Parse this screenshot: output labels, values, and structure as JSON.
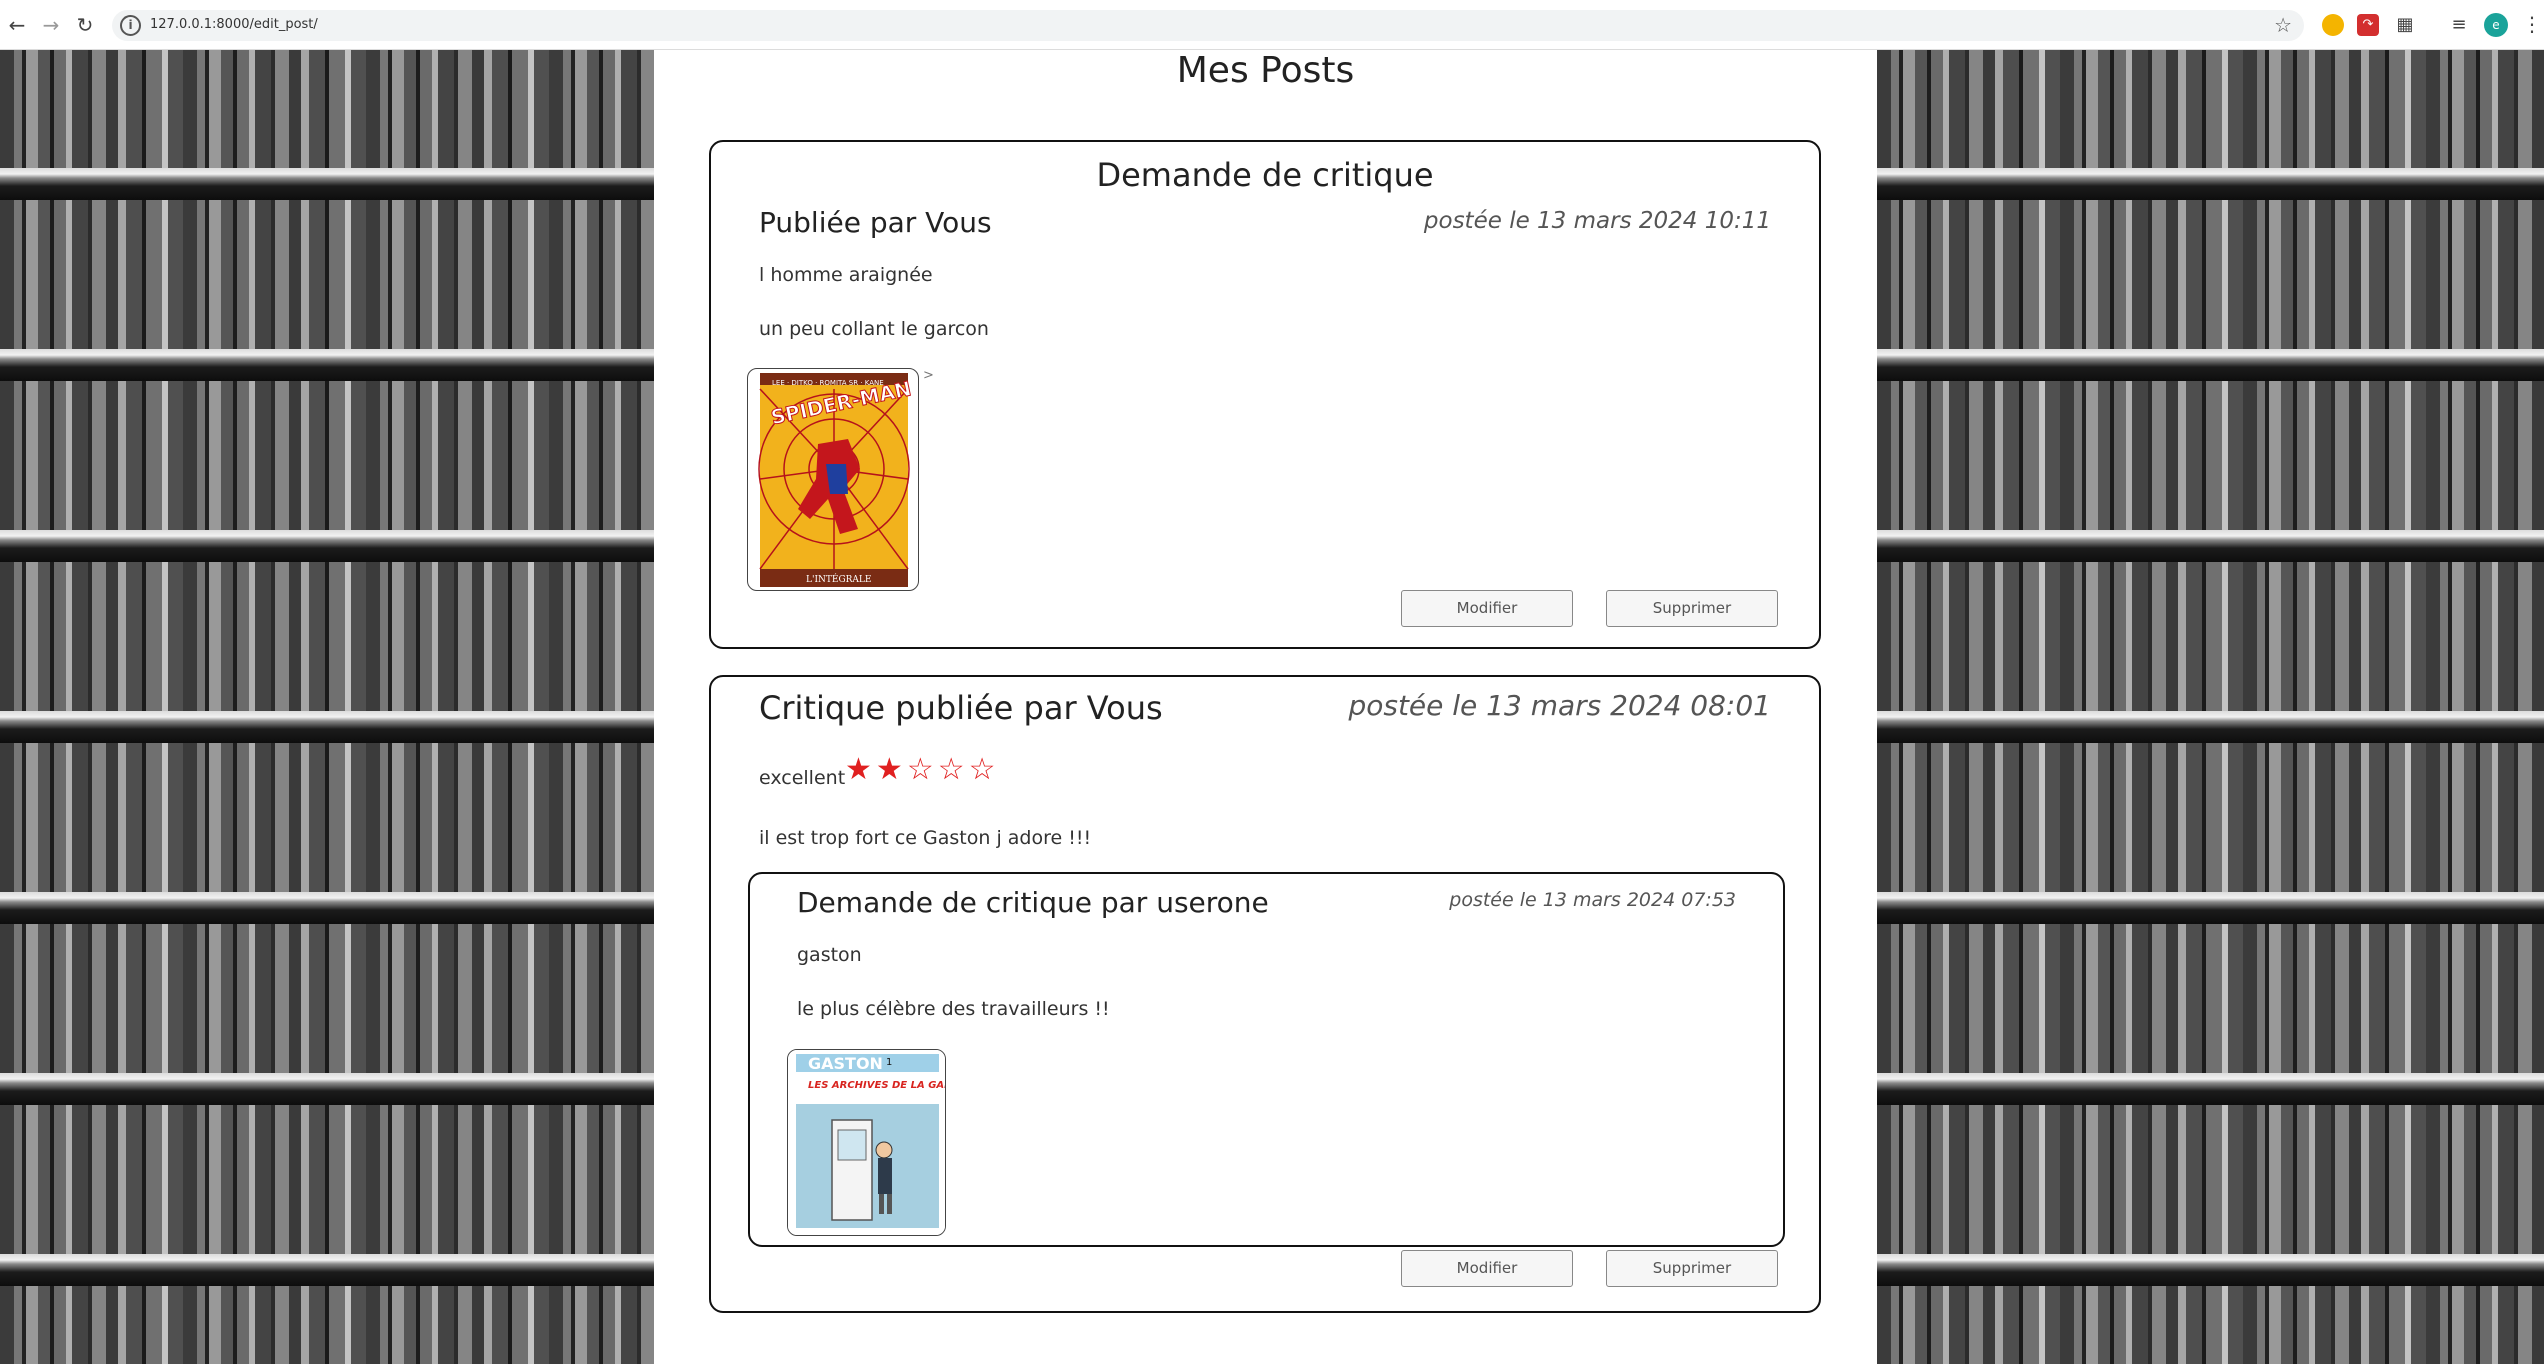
{
  "browser": {
    "url": "127.0.0.1:8000/edit_post/",
    "back_icon": "arrow-left-icon",
    "forward_icon": "arrow-right-icon",
    "reload_icon": "reload-icon",
    "site_info_icon": "info-icon",
    "bookmark_icon": "star-icon",
    "profile_initial": "e"
  },
  "page": {
    "title": "Mes Posts"
  },
  "posts": [
    {
      "card_title": "Demande de critique",
      "author": "Publiée par Vous",
      "date": "postée le 13 mars 2024 10:11",
      "book_title": "l homme araignée",
      "description": "un peu collant le garcon",
      "image_alt": "Spider-Man cover",
      "cover_top_text": "LEE · DITKO · ROMITA SR · KANE",
      "cover_logo": "SPIDER-MAN",
      "cover_bottom_text": "L'INTÉGRALE",
      "stray_text": ">",
      "modify_label": "Modifier",
      "delete_label": "Supprimer"
    },
    {
      "author": "Critique publiée par Vous",
      "date": "postée le 13 mars 2024 08:01",
      "headline": "excellent",
      "rating": 2,
      "rating_max": 5,
      "star_filled": "★",
      "star_empty": "☆",
      "body": "il est trop fort ce Gaston j adore !!!",
      "ticket": {
        "author": "Demande de critique par userone",
        "date": "postée le 13 mars 2024 07:53",
        "book_title": "gaston",
        "description": "le plus célèbre des travailleurs !!",
        "image_alt": "Gaston cover",
        "cover_logo": "GASTON",
        "cover_number": "1",
        "cover_subtitle": "LES ARCHIVES DE LA GAFFE"
      },
      "modify_label": "Modifier",
      "delete_label": "Supprimer"
    }
  ],
  "colors": {
    "star": "#e02020",
    "card_border": "#111111"
  }
}
